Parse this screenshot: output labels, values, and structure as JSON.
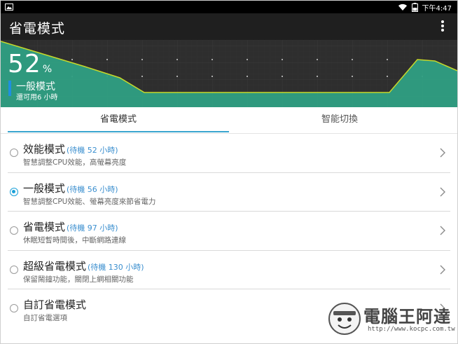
{
  "status_bar": {
    "time": "下午4:47",
    "icons": [
      "image-icon",
      "wifi-icon",
      "battery-icon"
    ]
  },
  "app_bar": {
    "title": "省電模式",
    "menu_icon": "more-vert-icon"
  },
  "battery_graph": {
    "percent": "52",
    "percent_unit": "%",
    "current_mode": "一般模式",
    "remaining": "還可用6 小時",
    "colors": {
      "background": "#2e2e2e",
      "fill": "#2f9f83",
      "line": "#c7d92a",
      "mode_indicator": "#1f8fe0"
    }
  },
  "tabs": [
    {
      "label": "省電模式",
      "selected": true
    },
    {
      "label": "智能切換",
      "selected": false
    }
  ],
  "modes": [
    {
      "name": "效能模式",
      "standby": "(待機 52 小時)",
      "desc": "智慧調整CPU效能，高螢幕亮度",
      "selected": false
    },
    {
      "name": "一般模式",
      "standby": "(待機 56 小時)",
      "desc": "智慧調整CPU效能、螢幕亮度來節省電力",
      "selected": true
    },
    {
      "name": "省電模式",
      "standby": "(待機 97 小時)",
      "desc": "休眠短暫時間後，中斷網路連線",
      "selected": false
    },
    {
      "name": "超級省電模式",
      "standby": "(待機 130 小時)",
      "desc": "保留鬧鐘功能，關閉上網相關功能",
      "selected": false
    },
    {
      "name": "自訂省電模式",
      "standby": "",
      "desc": "自訂省電選項",
      "selected": false
    }
  ],
  "watermark": {
    "name": "電腦王阿達",
    "url": "http://www.kocpc.com.tw"
  },
  "accent_color": "#1aa0d8"
}
